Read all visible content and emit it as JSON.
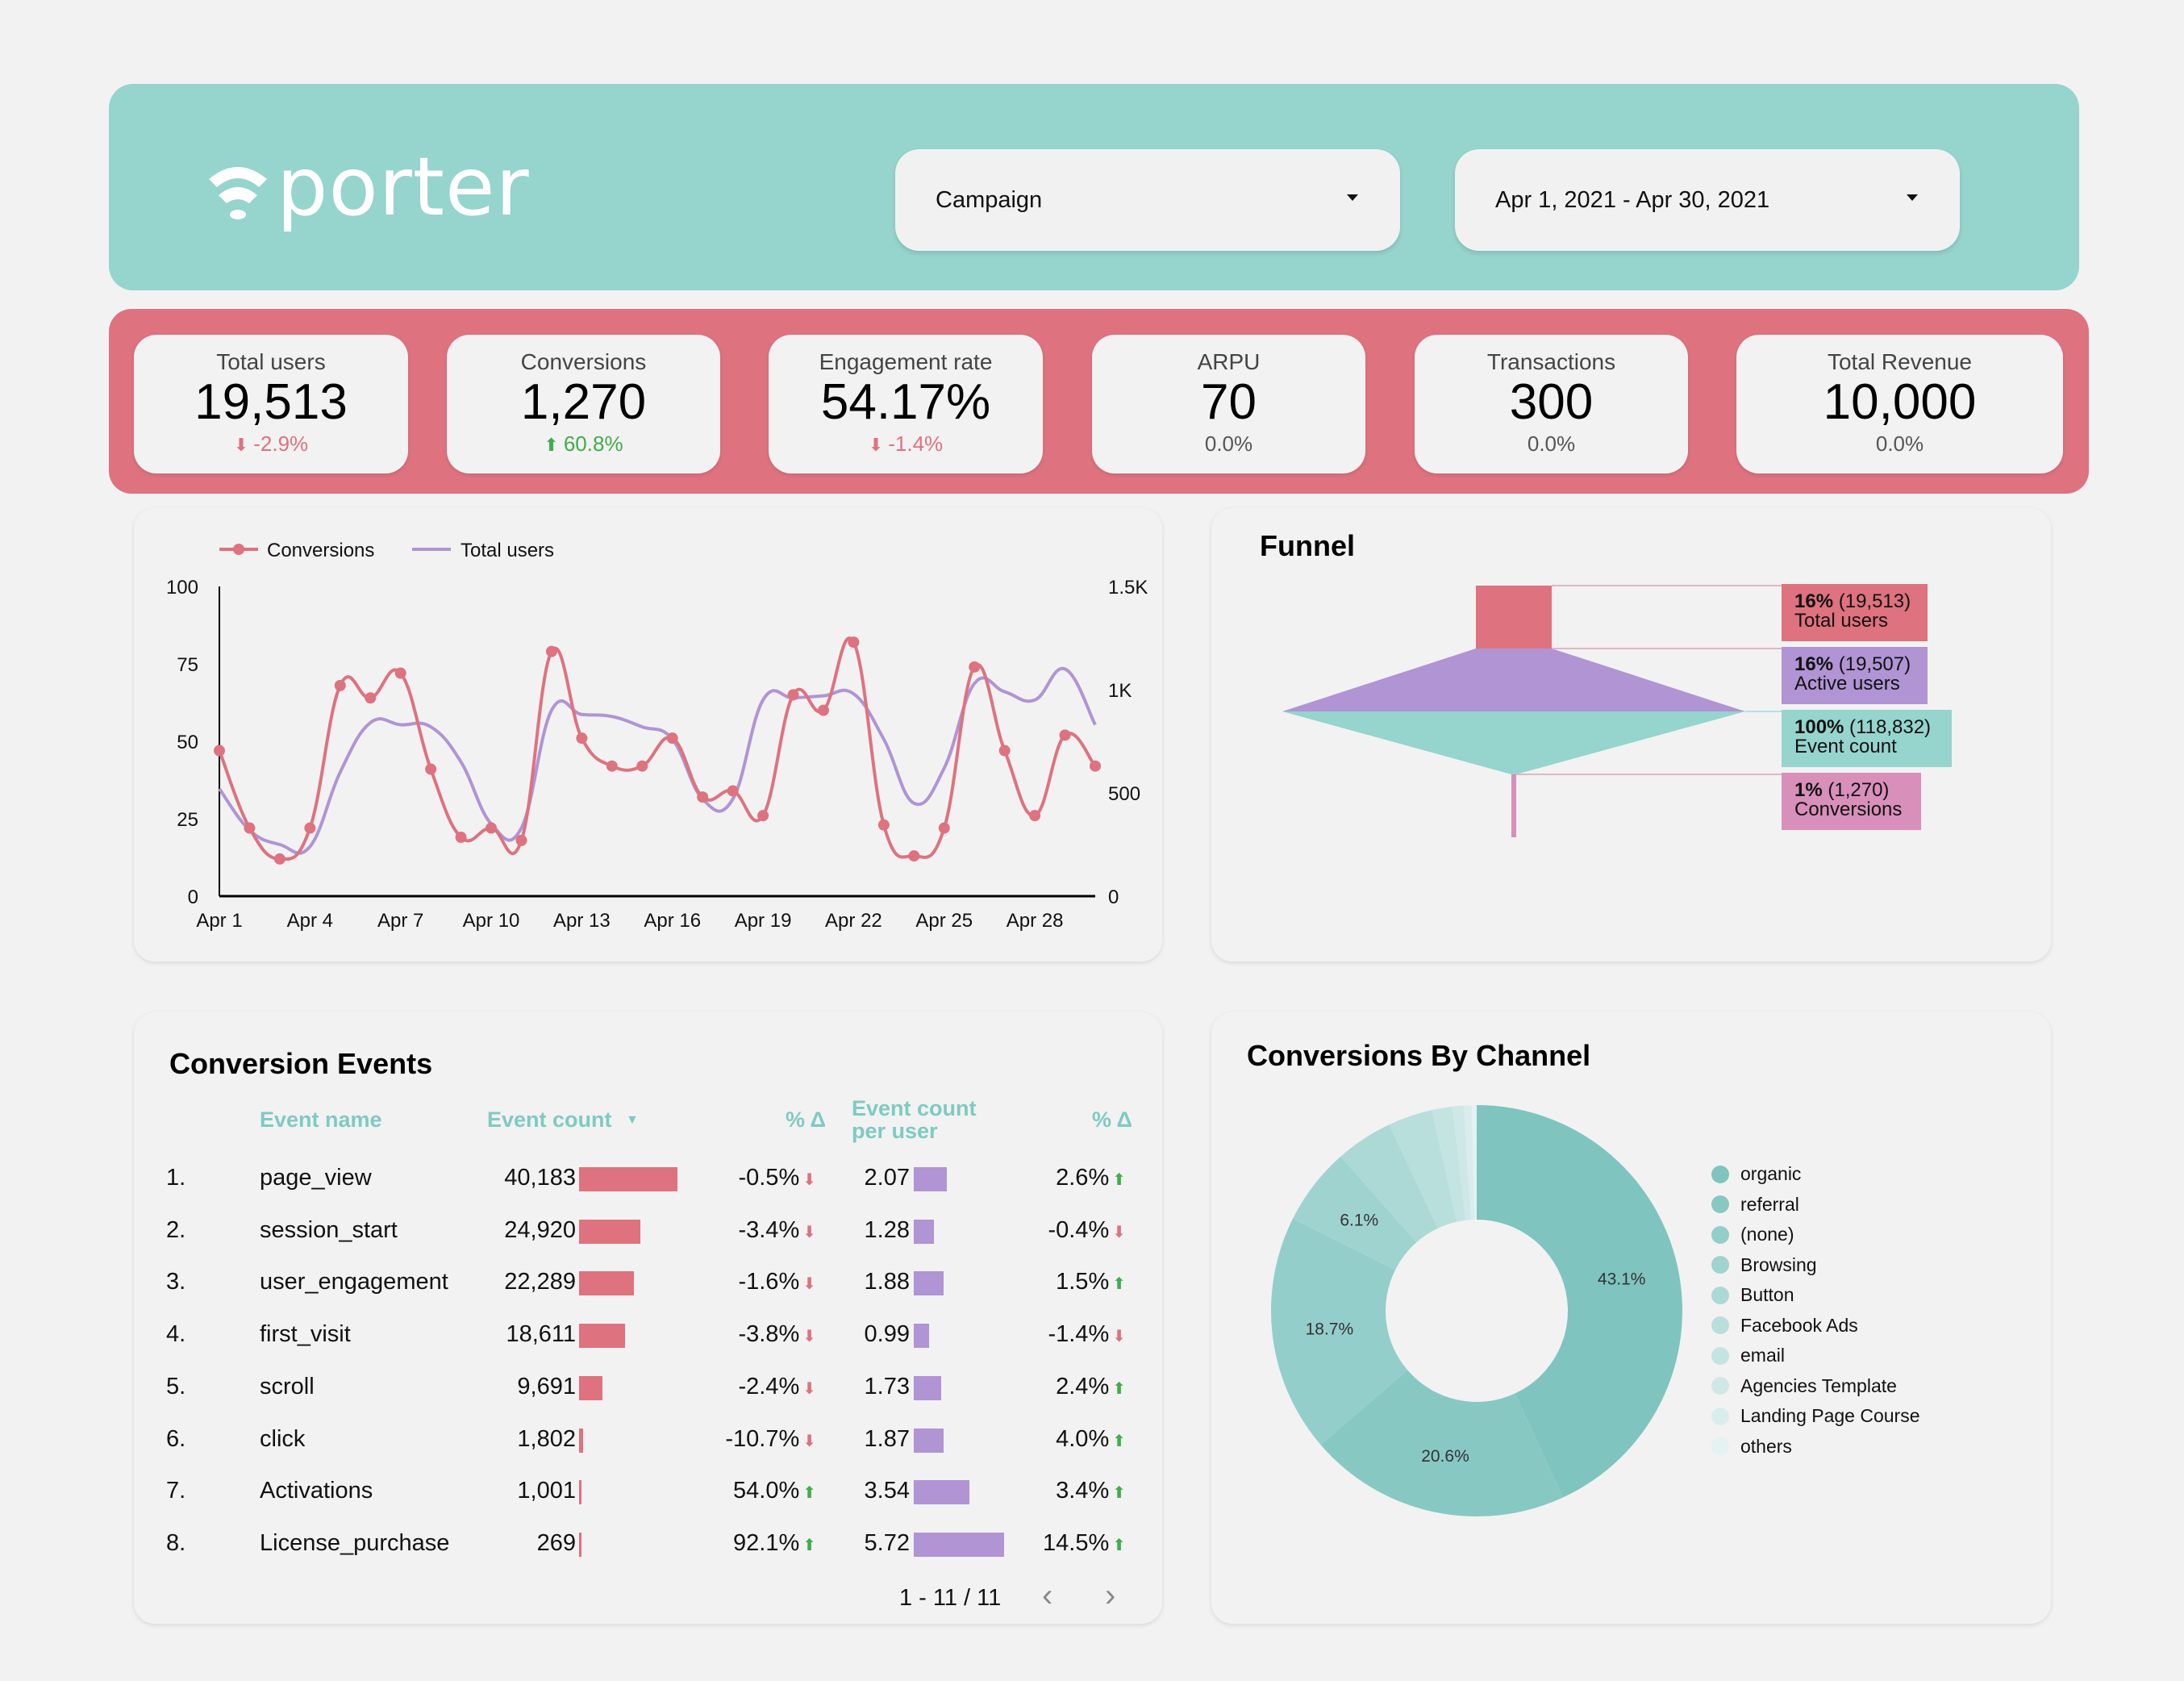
{
  "header": {
    "logo_text": "porter",
    "campaign_dropdown": {
      "value": "Campaign"
    },
    "date_dropdown": {
      "value": "Apr 1, 2021 - Apr 30, 2021"
    }
  },
  "colors": {
    "header_bg": "#96d4ce",
    "kpi_band_bg": "#de727f",
    "conversions": "#de727f",
    "total_users": "#b094d4",
    "teal": "#7fcac2",
    "pink": "#d88fba",
    "up": "#3fae49",
    "down": "#de727f"
  },
  "kpis": [
    {
      "label": "Total users",
      "value": "19,513",
      "delta": "-2.9%",
      "trend": "down"
    },
    {
      "label": "Conversions",
      "value": "1,270",
      "delta": "60.8%",
      "trend": "up"
    },
    {
      "label": "Engagement rate",
      "value": "54.17%",
      "delta": "-1.4%",
      "trend": "down"
    },
    {
      "label": "ARPU",
      "value": "70",
      "delta": "0.0%",
      "trend": "flat"
    },
    {
      "label": "Transactions",
      "value": "300",
      "delta": "0.0%",
      "trend": "flat"
    },
    {
      "label": "Total Revenue",
      "value": "10,000",
      "delta": "0.0%",
      "trend": "flat"
    }
  ],
  "chart_data": [
    {
      "type": "line",
      "title": "",
      "legend_position": "top-left",
      "x": [
        "Apr 1",
        "Apr 2",
        "Apr 3",
        "Apr 4",
        "Apr 5",
        "Apr 6",
        "Apr 7",
        "Apr 8",
        "Apr 9",
        "Apr 10",
        "Apr 11",
        "Apr 12",
        "Apr 13",
        "Apr 14",
        "Apr 15",
        "Apr 16",
        "Apr 17",
        "Apr 18",
        "Apr 19",
        "Apr 20",
        "Apr 21",
        "Apr 22",
        "Apr 23",
        "Apr 24",
        "Apr 25",
        "Apr 26",
        "Apr 27",
        "Apr 28",
        "Apr 29",
        "Apr 30"
      ],
      "x_tick_labels": [
        "Apr 1",
        "Apr 4",
        "Apr 7",
        "Apr 10",
        "Apr 13",
        "Apr 16",
        "Apr 19",
        "Apr 22",
        "Apr 25",
        "Apr 28"
      ],
      "series": [
        {
          "name": "Conversions",
          "axis": "left",
          "markers": true,
          "values": [
            47,
            22,
            12,
            22,
            68,
            64,
            72,
            41,
            19,
            22,
            18,
            79,
            51,
            42,
            42,
            51,
            32,
            34,
            26,
            65,
            60,
            82,
            23,
            13,
            22,
            74,
            47,
            26,
            52,
            42
          ]
        },
        {
          "name": "Total users",
          "axis": "right",
          "markers": false,
          "values": [
            520,
            320,
            250,
            240,
            600,
            840,
            830,
            820,
            650,
            350,
            330,
            900,
            880,
            870,
            820,
            760,
            470,
            470,
            950,
            960,
            970,
            980,
            760,
            450,
            620,
            1030,
            990,
            950,
            1100,
            830
          ]
        }
      ],
      "left_axis": {
        "ylim": [
          0,
          100
        ],
        "ticks": [
          "0",
          "25",
          "50",
          "75",
          "100"
        ]
      },
      "right_axis": {
        "ylim": [
          0,
          1500
        ],
        "ticks": [
          "0",
          "500",
          "1K",
          "1.5K"
        ]
      },
      "grid": false
    },
    {
      "type": "funnel",
      "title": "Funnel",
      "stages": [
        {
          "name": "Total users",
          "percent": "16%",
          "value": "19,513",
          "raw": 19513,
          "color": "#de727f"
        },
        {
          "name": "Active users",
          "percent": "16%",
          "value": "19,507",
          "raw": 19507,
          "color": "#b094d4"
        },
        {
          "name": "Event count",
          "percent": "100%",
          "value": "118,832",
          "raw": 118832,
          "color": "#96d4ce"
        },
        {
          "name": "Conversions",
          "percent": "1%",
          "value": "1,270",
          "raw": 1270,
          "color": "#d88fba"
        }
      ]
    },
    {
      "type": "pie",
      "title": "Conversions By Channel",
      "donut": true,
      "legend_position": "right",
      "slices": [
        {
          "label": "organic",
          "value": 43.1,
          "color": "#7fc4bf",
          "show_label": true
        },
        {
          "label": "referral",
          "value": 20.6,
          "color": "#88c8c3",
          "show_label": true
        },
        {
          "label": "(none)",
          "value": 18.7,
          "color": "#93ceca",
          "show_label": true
        },
        {
          "label": "Browsing",
          "value": 6.1,
          "color": "#9fd3cf",
          "show_label": true
        },
        {
          "label": "Button",
          "value": 4.5,
          "color": "#acd9d6",
          "show_label": false
        },
        {
          "label": "Facebook Ads",
          "value": 3.5,
          "color": "#b8dfdc",
          "show_label": false
        },
        {
          "label": "email",
          "value": 1.6,
          "color": "#c4e4e2",
          "show_label": false
        },
        {
          "label": "Agencies Template",
          "value": 0.9,
          "color": "#cfe8e7",
          "show_label": false
        },
        {
          "label": "Landing Page Course",
          "value": 0.6,
          "color": "#d9edec",
          "show_label": false
        },
        {
          "label": "others",
          "value": 0.4,
          "color": "#e4f2f1",
          "show_label": false
        }
      ]
    }
  ],
  "table": {
    "title": "Conversion Events",
    "columns": [
      "Event name",
      "Event count",
      "% Δ",
      "Event count per user",
      "% Δ"
    ],
    "sort_column": "Event count",
    "rows": [
      {
        "rank": "1.",
        "name": "page_view",
        "count": "40,183",
        "count_raw": 40183,
        "count_delta": "-0.5%",
        "count_trend": "down",
        "per_user": "2.07",
        "per_user_raw": 2.07,
        "per_user_delta": "2.6%",
        "per_user_trend": "up"
      },
      {
        "rank": "2.",
        "name": "session_start",
        "count": "24,920",
        "count_raw": 24920,
        "count_delta": "-3.4%",
        "count_trend": "down",
        "per_user": "1.28",
        "per_user_raw": 1.28,
        "per_user_delta": "-0.4%",
        "per_user_trend": "down"
      },
      {
        "rank": "3.",
        "name": "user_engagement",
        "count": "22,289",
        "count_raw": 22289,
        "count_delta": "-1.6%",
        "count_trend": "down",
        "per_user": "1.88",
        "per_user_raw": 1.88,
        "per_user_delta": "1.5%",
        "per_user_trend": "up"
      },
      {
        "rank": "4.",
        "name": "first_visit",
        "count": "18,611",
        "count_raw": 18611,
        "count_delta": "-3.8%",
        "count_trend": "down",
        "per_user": "0.99",
        "per_user_raw": 0.99,
        "per_user_delta": "-1.4%",
        "per_user_trend": "down"
      },
      {
        "rank": "5.",
        "name": "scroll",
        "count": "9,691",
        "count_raw": 9691,
        "count_delta": "-2.4%",
        "count_trend": "down",
        "per_user": "1.73",
        "per_user_raw": 1.73,
        "per_user_delta": "2.4%",
        "per_user_trend": "up"
      },
      {
        "rank": "6.",
        "name": "click",
        "count": "1,802",
        "count_raw": 1802,
        "count_delta": "-10.7%",
        "count_trend": "down",
        "per_user": "1.87",
        "per_user_raw": 1.87,
        "per_user_delta": "4.0%",
        "per_user_trend": "up"
      },
      {
        "rank": "7.",
        "name": "Activations",
        "count": "1,001",
        "count_raw": 1001,
        "count_delta": "54.0%",
        "count_trend": "up",
        "per_user": "3.54",
        "per_user_raw": 3.54,
        "per_user_delta": "3.4%",
        "per_user_trend": "up"
      },
      {
        "rank": "8.",
        "name": "License_purchase",
        "count": "269",
        "count_raw": 269,
        "count_delta": "92.1%",
        "count_trend": "up",
        "per_user": "5.72",
        "per_user_raw": 5.72,
        "per_user_delta": "14.5%",
        "per_user_trend": "up"
      }
    ],
    "pagination": {
      "text": "1 - 11 / 11",
      "prev": "‹",
      "next": "›"
    }
  },
  "icons": {
    "down_arrow": "⬇",
    "up_arrow": "⬆",
    "caret": "dropdown-caret",
    "logo": "wifi-signal"
  }
}
